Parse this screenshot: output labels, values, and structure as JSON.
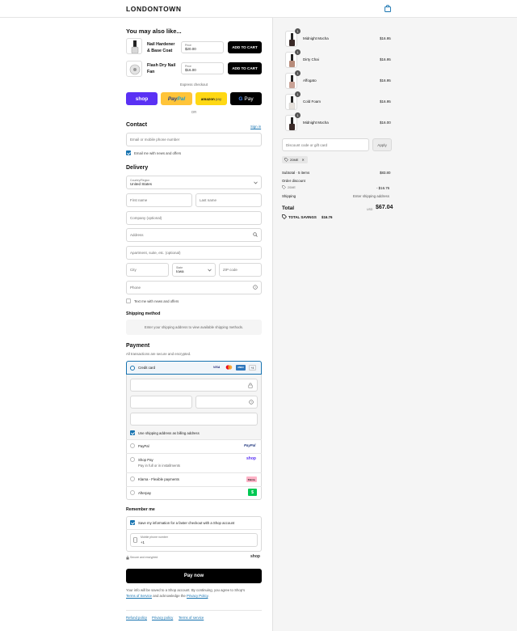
{
  "brand": {
    "logo": "LONDONTOWN"
  },
  "upsell": {
    "title": "You may also like...",
    "items": [
      {
        "name_line1": "Nail Hardener",
        "name_line2": "& Base Coat",
        "price_label": "Price",
        "price": "$20.00",
        "button": "ADD TO CART"
      },
      {
        "name_line1": "Flash Dry Nail",
        "name_line2": "Fan",
        "price_label": "Price",
        "price": "$16.00",
        "button": "ADD TO CART"
      }
    ]
  },
  "express": {
    "label": "Express checkout",
    "or": "OR",
    "buttons": {
      "shop": "shop",
      "paypal_a": "Pay",
      "paypal_b": "Pal",
      "amazon_a": "amazon",
      "amazon_b": "pay",
      "gpay_g": "G",
      "gpay": "Pay"
    }
  },
  "contact": {
    "title": "Contact",
    "sign_in": "Sign in",
    "email_placeholder": "Email or mobile phone number",
    "news_label": "Email me with news and offers"
  },
  "delivery": {
    "title": "Delivery",
    "country_label": "Country/Region",
    "country": "United States",
    "first_name": "First name",
    "last_name": "Last name",
    "company": "Company (optional)",
    "address": "Address",
    "apartment": "Apartment, suite, etc. (optional)",
    "city": "City",
    "state_label": "State",
    "state": "Iowa",
    "zip": "ZIP code",
    "phone": "Phone",
    "text_label": "Text me with news and offers"
  },
  "shipping": {
    "title": "Shipping method",
    "message": "Enter your shipping address to view available shipping methods."
  },
  "payment": {
    "title": "Payment",
    "subtitle": "All transactions are secure and encrypted.",
    "credit_card": "Credit card",
    "cards": {
      "visa": "VISA",
      "amex": "AMEX",
      "more": "+4"
    },
    "billing_label": "Use shipping address as billing address",
    "options": [
      {
        "label": "PayPal",
        "sub": "",
        "logo": "PayPal"
      },
      {
        "label": "Shop Pay",
        "sub": "Pay in full or in installments",
        "logo": "shop"
      },
      {
        "label": "Klarna - Flexible payments",
        "sub": "",
        "logo": "Klarna."
      },
      {
        "label": "Afterpay",
        "sub": "",
        "logo": "$"
      }
    ]
  },
  "remember": {
    "title": "Remember me",
    "save_label": "Save my information for a faster checkout with a Shop account",
    "mobile_label": "Mobile phone number",
    "mobile_prefix": "+1",
    "secure": "Secure and encrypted",
    "shop_logo": "shop"
  },
  "pay_now": "Pay now",
  "legal": {
    "line1": "Your info will be saved to a Shop account. By continuing, you agree to Shop's",
    "terms": "Terms of Service",
    "and": " and acknowledge the ",
    "privacy": "Privacy Policy",
    "period": "."
  },
  "footer": {
    "refund": "Refund policy",
    "privacy": "Privacy policy",
    "terms": "Terms of service"
  },
  "cart": {
    "items": [
      {
        "name": "Midnight Mocha",
        "price": "$16.95",
        "qty": "1",
        "color": "#3a2a28"
      },
      {
        "name": "Dirty Chai",
        "price": "$16.95",
        "qty": "1",
        "color": "#b78b7a"
      },
      {
        "name": "Affogato",
        "price": "$16.95",
        "qty": "1",
        "color": "#c9a296"
      },
      {
        "name": "Cold Foam",
        "price": "$16.95",
        "qty": "1",
        "color": "#e6e1dc"
      },
      {
        "name": "Midnight Mocha",
        "price": "$16.00",
        "qty": "1",
        "color": "#3a2a28"
      }
    ],
    "discount_placeholder": "Discount code or gift card",
    "apply": "Apply",
    "tag": "20ME",
    "subtotal_label": "Subtotal · 5 items",
    "subtotal": "$83.80",
    "order_discount": "Order discount",
    "code": "20ME",
    "discount": "- $16.76",
    "shipping_label": "Shipping",
    "shipping_value": "Enter shipping address",
    "total_label": "Total",
    "currency": "USD",
    "total": "$67.04",
    "savings_label": "TOTAL SAVINGS",
    "savings": "$16.76"
  }
}
